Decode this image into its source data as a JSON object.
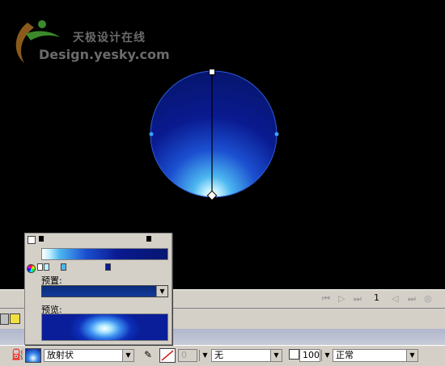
{
  "watermark": {
    "cn": "天极设计在线",
    "en": "Design.yesky.com"
  },
  "timeline": {
    "frame": "1"
  },
  "gradient_panel": {
    "preset_label": "预置:",
    "preview_label": "预览:"
  },
  "properties": {
    "fill_type": "放射状",
    "stroke_width": "0",
    "stroke_style": "无",
    "alpha": "100",
    "blend_mode": "正常"
  },
  "colors": {
    "fill_dark": "#061670",
    "fill_light": "#ffffff",
    "fill_mid": "#1b4fd0"
  }
}
